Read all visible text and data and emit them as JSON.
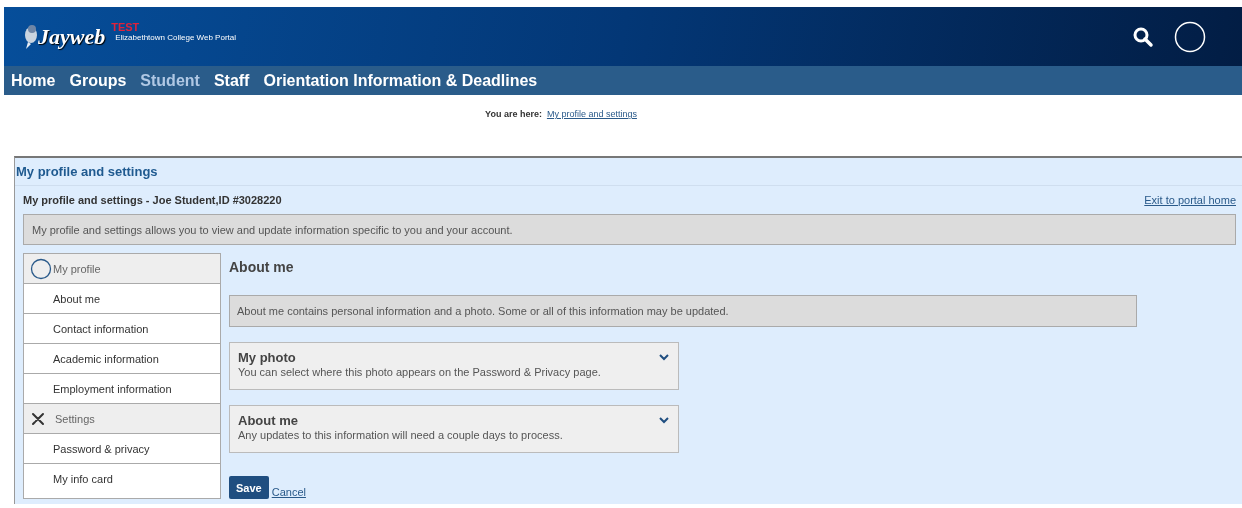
{
  "header": {
    "logo_text": "Jayweb",
    "badge": "TEST",
    "portal_name": "Elizabethtown College Web Portal"
  },
  "nav": [
    {
      "label": "Home",
      "selected": false
    },
    {
      "label": "Groups",
      "selected": false
    },
    {
      "label": "Student",
      "selected": true
    },
    {
      "label": "Staff",
      "selected": false
    },
    {
      "label": "Orientation Information & Deadlines",
      "selected": false
    }
  ],
  "breadcrumb": {
    "label": "You are here:",
    "link": "My profile and settings"
  },
  "panel": {
    "title": "My profile and settings",
    "subtitle": "My profile and settings - Joe Student,ID #3028220",
    "exit_link": "Exit to portal home",
    "description": "My profile and settings allows you to view and update information specific to you and your account."
  },
  "sidebar": {
    "items": [
      {
        "kind": "section",
        "label": "My profile"
      },
      {
        "kind": "link",
        "label": "About me"
      },
      {
        "kind": "link",
        "label": "Contact information"
      },
      {
        "kind": "link",
        "label": "Academic information"
      },
      {
        "kind": "link",
        "label": "Employment information"
      },
      {
        "kind": "section",
        "label": "Settings"
      },
      {
        "kind": "link",
        "label": "Password & privacy"
      },
      {
        "kind": "link",
        "label": "My info card"
      }
    ]
  },
  "content": {
    "heading": "About me",
    "info": "About me contains personal information and a photo. Some or all of this information may be updated.",
    "sections": [
      {
        "title": "My photo",
        "description": "You can select where this photo appears on the Password & Privacy page.",
        "expanded": false
      },
      {
        "title": "About me",
        "description": "Any updates to this information will need a couple days to process.",
        "expanded": false
      }
    ],
    "buttons": [
      {
        "kind": "primary",
        "label": "Save"
      },
      {
        "kind": "link",
        "label": "Cancel"
      }
    ]
  }
}
